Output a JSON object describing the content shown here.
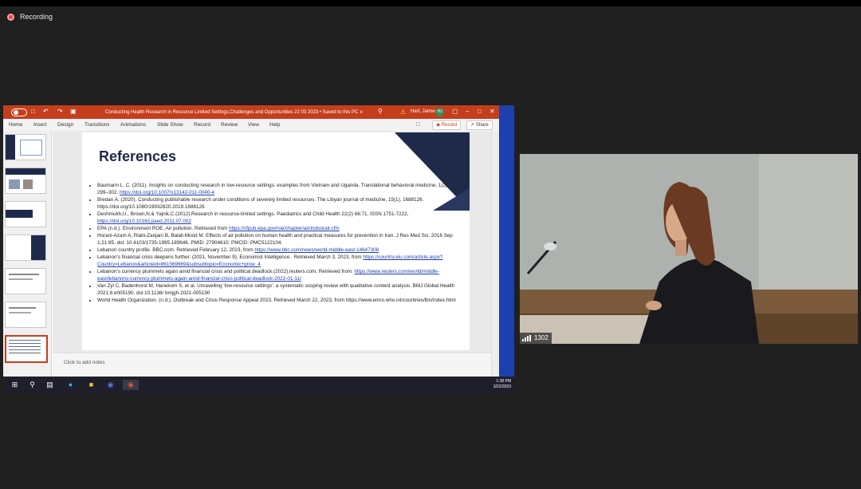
{
  "recording": {
    "label": "Recording"
  },
  "presentation": {
    "window_title": "Conducting Health Research in Resource Limited Settings,Challenges and Opportunities 22 03 2023 • Saved to this PC ∨",
    "user_name": "Hart, Jaime",
    "user_initials": "HJ",
    "ribbon_tabs": [
      "Home",
      "Insert",
      "Design",
      "Transitions",
      "Animations",
      "Slide Show",
      "Record",
      "Review",
      "View",
      "Help"
    ],
    "record_button": "Record",
    "share_button": "Share",
    "notes_placeholder": "Click to add notes",
    "slide": {
      "title": "References",
      "references": [
        {
          "text": "Baumann L. C. (2011). Insights on conducting research in low-resource settings: examples from Vietnam and Uganda. Translational behavioral medicine, 1(2), 299–302. ",
          "link": "https://doi.org/10.1007/s13142-011-0040-4"
        },
        {
          "text": "Bredan A. (2020). Conducting publishable research under conditions of severely limited resources. The Libyan journal of medicine, 15(1), 1688126. https://doi.org/10.1080/19932820.2019.1688126",
          "link": ""
        },
        {
          "text": "Deshmukh,U., Brown,N.& Yajnik,C.(2012).Research in resource-limited settings. Paediatrics and Child Health 22(2) 66:71, ISSN 1751-7222, ",
          "link": "https://doi.org/10.1016/j.paed.2011.07.002"
        },
        {
          "text": "EPA (n.d.). Environment ROE, Air pollution. Retrieved from  ",
          "link": "https://cfpub.epa.gov/roe/chapter/air/indoorair.cfm"
        },
        {
          "text": "Horani-Azam A, Riahi-Zanjani B, Balali-Mood M. Effects of air pollution on human health and practical measures for prevention in Iran. J Res Med Sci. 2016 Sep 1;21:65. doi: 10.4103/1735-1995.189646. PMID: 27904610; PMCID: PMC5122104.",
          "link": ""
        },
        {
          "text": "Lebanon country profile. BBC.com. Retrieved February 12, 2023, from ",
          "link": "https://www.bbc.com/news/world-middle-east-14647308"
        },
        {
          "text": "Lebanon's financial crisis deepens further. (2021, November 9). Economist Intelligence . Retrieved March 3, 2023, from ",
          "link": "https://country.eiu.com/article.aspx?Country=Lebanon&articleid=861569669&subsubtopic=Economic+grow_4"
        },
        {
          "text": "Lebanon's currency plummets again amid financial crisis and political deadlock.(2022).reuters.com. Retrieved from: ",
          "link": "https://www.reuters.com/world/middle-east/lebanons-currency-plummets-again-amid-financial-crisis-political-deadlock-2022-01-11/"
        },
        {
          "text": " Van Zyl C, Badenhorst M, Hanekom S, et al. Unravelling 'low-resource settings': a systematic scoping review with qualitative content analysis. BMJ Global Health 2021;6:e005190. doi:10.1136/ bmjgh-2021-005190",
          "link": ""
        },
        {
          "text": "World Health Organization. (n.d.). Outbreak and Crisis Response Appeal 2023. Retrieved March 22, 2023, from https://www.emro.who.int/countries/lbn/index.html",
          "link": ""
        }
      ]
    },
    "clock": {
      "time": "1:38 PM",
      "date": "3/22/2023"
    }
  },
  "video": {
    "participant_count": "1302"
  },
  "colors": {
    "ppt_accent": "#c43e1c",
    "slide_navy": "#1f2a4a",
    "link": "#1a3cae"
  }
}
